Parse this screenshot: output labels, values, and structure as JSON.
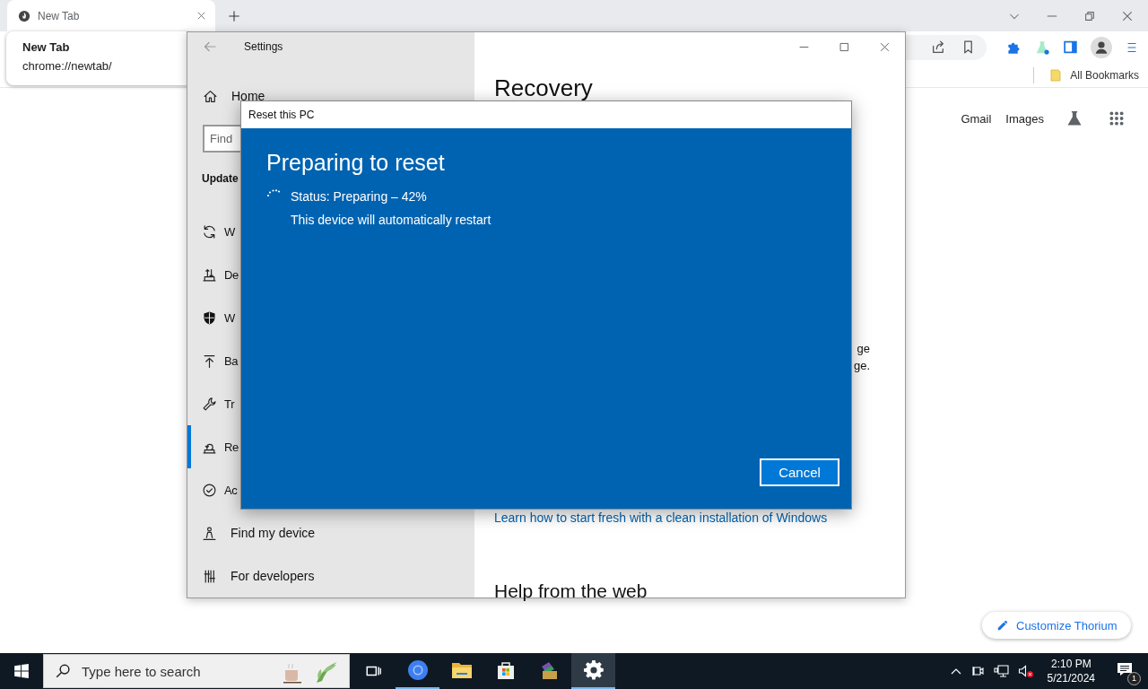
{
  "browser": {
    "tabs": [
      {
        "title": "New Tab",
        "selected": true
      }
    ],
    "tab_tooltip": {
      "title": "New Tab",
      "url": "chrome://newtab/"
    },
    "bookmarks_bar": [
      "All Bookmarks"
    ],
    "new_tab_page": {
      "links": [
        "Gmail",
        "Images"
      ],
      "customize_button": "Customize Thorium"
    }
  },
  "settings": {
    "title": "Settings",
    "home": "Home",
    "search": {
      "placeholder": "Find"
    },
    "group_heading": "Update",
    "nav_items": [
      {
        "label": "W",
        "selected": false
      },
      {
        "label": "De",
        "selected": false
      },
      {
        "label": "W",
        "selected": false
      },
      {
        "label": "Ba",
        "selected": false
      },
      {
        "label": "Tr",
        "selected": false
      },
      {
        "label": "Re",
        "selected": true
      },
      {
        "label": "Ac",
        "selected": false
      },
      {
        "label": "Find my device",
        "selected": false
      },
      {
        "label": "For developers",
        "selected": false
      }
    ],
    "page_title": "Recovery",
    "text_fragments": [
      "ge",
      "ge."
    ],
    "link": "Learn how to start fresh with a clean installation of Windows",
    "help_heading": "Help from the web"
  },
  "dialog": {
    "title": "Reset this PC",
    "heading": "Preparing to reset",
    "status": "Status: Preparing – 42%",
    "note": "This device will automatically restart",
    "button": "Cancel"
  },
  "taskbar": {
    "search": {
      "placeholder": "Type here to search"
    },
    "apps": [
      {
        "selected": false,
        "running": true
      },
      {
        "selected": false,
        "running": false
      },
      {
        "selected": false,
        "running": false
      },
      {
        "selected": false,
        "running": false
      },
      {
        "selected": true,
        "running": true
      }
    ],
    "time": "2:10 PM",
    "date": "5/21/2024",
    "notifications": "1"
  }
}
